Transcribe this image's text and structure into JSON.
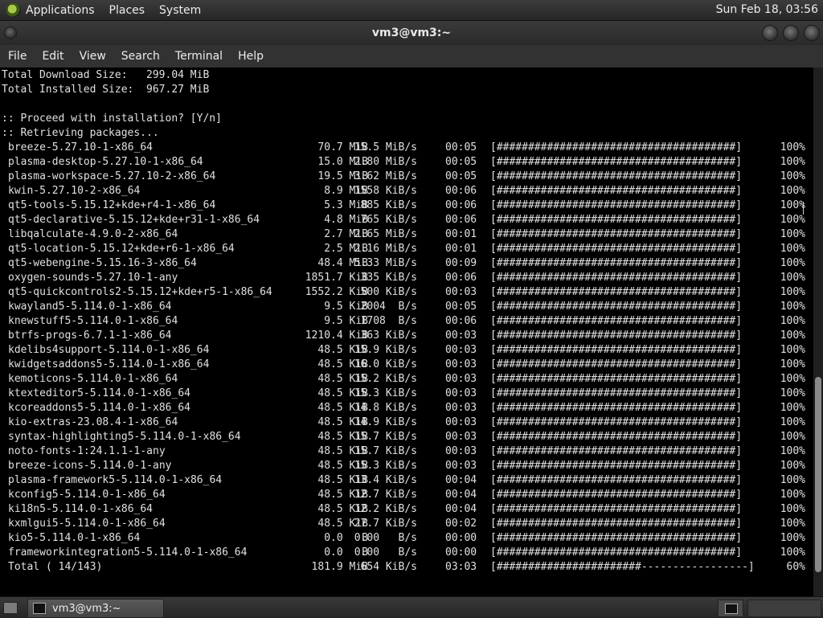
{
  "top_panel": {
    "menus": [
      "Applications",
      "Places",
      "System"
    ],
    "clock": "Sun Feb 18, 03:56"
  },
  "window": {
    "title": "vm3@vm3:~",
    "menus": [
      "File",
      "Edit",
      "View",
      "Search",
      "Terminal",
      "Help"
    ]
  },
  "terminal": {
    "header_lines": [
      "Total Download Size:   299.04 MiB",
      "Total Installed Size:  967.27 MiB",
      "",
      ":: Proceed with installation? [Y/n]",
      ":: Retrieving packages..."
    ],
    "downloads": [
      {
        "name": "breeze-5.27.10-1-x86_64",
        "size": "70.7 MiB",
        "rate": "15.5 MiB/s",
        "time": "00:05",
        "bar": "[######################################]",
        "pct": "100%"
      },
      {
        "name": "plasma-desktop-5.27.10-1-x86_64",
        "size": "15.0 MiB",
        "rate": "2.80 MiB/s",
        "time": "00:05",
        "bar": "[######################################]",
        "pct": "100%"
      },
      {
        "name": "plasma-workspace-5.27.10-2-x86_64",
        "size": "19.5 MiB",
        "rate": "3.62 MiB/s",
        "time": "00:05",
        "bar": "[######################################]",
        "pct": "100%"
      },
      {
        "name": "kwin-5.27.10-2-x86_64",
        "size": "8.9 MiB",
        "rate": "1558 KiB/s",
        "time": "00:06",
        "bar": "[######################################]",
        "pct": "100%"
      },
      {
        "name": "qt5-tools-5.15.12+kde+r4-1-x86_64",
        "size": "5.3 MiB",
        "rate": "885 KiB/s",
        "time": "00:06",
        "bar": "[######################################]",
        "pct": "100%"
      },
      {
        "name": "qt5-declarative-5.15.12+kde+r31-1-x86_64",
        "size": "4.8 MiB",
        "rate": "765 KiB/s",
        "time": "00:06",
        "bar": "[######################################]",
        "pct": "100%"
      },
      {
        "name": "libqalculate-4.9.0-2-x86_64",
        "size": "2.7 MiB",
        "rate": "2.65 MiB/s",
        "time": "00:01",
        "bar": "[######################################]",
        "pct": "100%"
      },
      {
        "name": "qt5-location-5.15.12+kde+r6-1-x86_64",
        "size": "2.5 MiB",
        "rate": "2.16 MiB/s",
        "time": "00:01",
        "bar": "[######################################]",
        "pct": "100%"
      },
      {
        "name": "qt5-webengine-5.15.16-3-x86_64",
        "size": "48.4 MiB",
        "rate": "5.33 MiB/s",
        "time": "00:09",
        "bar": "[######################################]",
        "pct": "100%"
      },
      {
        "name": "oxygen-sounds-5.27.10-1-any",
        "size": "1851.7 KiB",
        "rate": "335 KiB/s",
        "time": "00:06",
        "bar": "[######################################]",
        "pct": "100%"
      },
      {
        "name": "qt5-quickcontrols2-5.15.12+kde+r5-1-x86_64",
        "size": "1552.2 KiB",
        "rate": "500 KiB/s",
        "time": "00:03",
        "bar": "[######################################]",
        "pct": "100%"
      },
      {
        "name": "kwayland5-5.114.0-1-x86_64",
        "size": "9.5 KiB",
        "rate": "2004  B/s",
        "time": "00:05",
        "bar": "[######################################]",
        "pct": "100%"
      },
      {
        "name": "knewstuff5-5.114.0-1-x86_64",
        "size": "9.5 KiB",
        "rate": "1708  B/s",
        "time": "00:06",
        "bar": "[######################################]",
        "pct": "100%"
      },
      {
        "name": "btrfs-progs-6.7.1-1-x86_64",
        "size": "1210.4 KiB",
        "rate": "363 KiB/s",
        "time": "00:03",
        "bar": "[######################################]",
        "pct": "100%"
      },
      {
        "name": "kdelibs4support-5.114.0-1-x86_64",
        "size": "48.5 KiB",
        "rate": "15.9 KiB/s",
        "time": "00:03",
        "bar": "[######################################]",
        "pct": "100%"
      },
      {
        "name": "kwidgetsaddons5-5.114.0-1-x86_64",
        "size": "48.5 KiB",
        "rate": "16.0 KiB/s",
        "time": "00:03",
        "bar": "[######################################]",
        "pct": "100%"
      },
      {
        "name": "kemoticons-5.114.0-1-x86_64",
        "size": "48.5 KiB",
        "rate": "15.2 KiB/s",
        "time": "00:03",
        "bar": "[######################################]",
        "pct": "100%"
      },
      {
        "name": "ktexteditor5-5.114.0-1-x86_64",
        "size": "48.5 KiB",
        "rate": "15.3 KiB/s",
        "time": "00:03",
        "bar": "[######################################]",
        "pct": "100%"
      },
      {
        "name": "kcoreaddons5-5.114.0-1-x86_64",
        "size": "48.5 KiB",
        "rate": "14.8 KiB/s",
        "time": "00:03",
        "bar": "[######################################]",
        "pct": "100%"
      },
      {
        "name": "kio-extras-23.08.4-1-x86_64",
        "size": "48.5 KiB",
        "rate": "14.9 KiB/s",
        "time": "00:03",
        "bar": "[######################################]",
        "pct": "100%"
      },
      {
        "name": "syntax-highlighting5-5.114.0-1-x86_64",
        "size": "48.5 KiB",
        "rate": "15.7 KiB/s",
        "time": "00:03",
        "bar": "[######################################]",
        "pct": "100%"
      },
      {
        "name": "noto-fonts-1:24.1.1-1-any",
        "size": "48.5 KiB",
        "rate": "15.7 KiB/s",
        "time": "00:03",
        "bar": "[######################################]",
        "pct": "100%"
      },
      {
        "name": "breeze-icons-5.114.0-1-any",
        "size": "48.5 KiB",
        "rate": "15.3 KiB/s",
        "time": "00:03",
        "bar": "[######################################]",
        "pct": "100%"
      },
      {
        "name": "plasma-framework5-5.114.0-1-x86_64",
        "size": "48.5 KiB",
        "rate": "13.4 KiB/s",
        "time": "00:04",
        "bar": "[######################################]",
        "pct": "100%"
      },
      {
        "name": "kconfig5-5.114.0-1-x86_64",
        "size": "48.5 KiB",
        "rate": "12.7 KiB/s",
        "time": "00:04",
        "bar": "[######################################]",
        "pct": "100%"
      },
      {
        "name": "ki18n5-5.114.0-1-x86_64",
        "size": "48.5 KiB",
        "rate": "12.2 KiB/s",
        "time": "00:04",
        "bar": "[######################################]",
        "pct": "100%"
      },
      {
        "name": "kxmlgui5-5.114.0-1-x86_64",
        "size": "48.5 KiB",
        "rate": "27.7 KiB/s",
        "time": "00:02",
        "bar": "[######################################]",
        "pct": "100%"
      },
      {
        "name": "kio5-5.114.0-1-x86_64",
        "size": "0.0   B",
        "rate": "0.00   B/s",
        "time": "00:00",
        "bar": "[######################################]",
        "pct": "100%"
      },
      {
        "name": "frameworkintegration5-5.114.0-1-x86_64",
        "size": "0.0   B",
        "rate": "0.00   B/s",
        "time": "00:00",
        "bar": "[######################################]",
        "pct": "100%"
      },
      {
        "name": "Total ( 14/143)",
        "size": "181.9 MiB",
        "rate": "654 KiB/s",
        "time": "03:03",
        "bar": "[#######################-----------------]",
        "pct": "60%"
      }
    ]
  },
  "scrollbar": {
    "position_fraction": 0.63,
    "visible_fraction": 0.37
  },
  "taskbar": {
    "task_label": "vm3@vm3:~"
  },
  "colors": {
    "terminal_bg": "#000000",
    "terminal_fg": "#e0e0e0",
    "panel_bg": "#2e2e2e"
  }
}
